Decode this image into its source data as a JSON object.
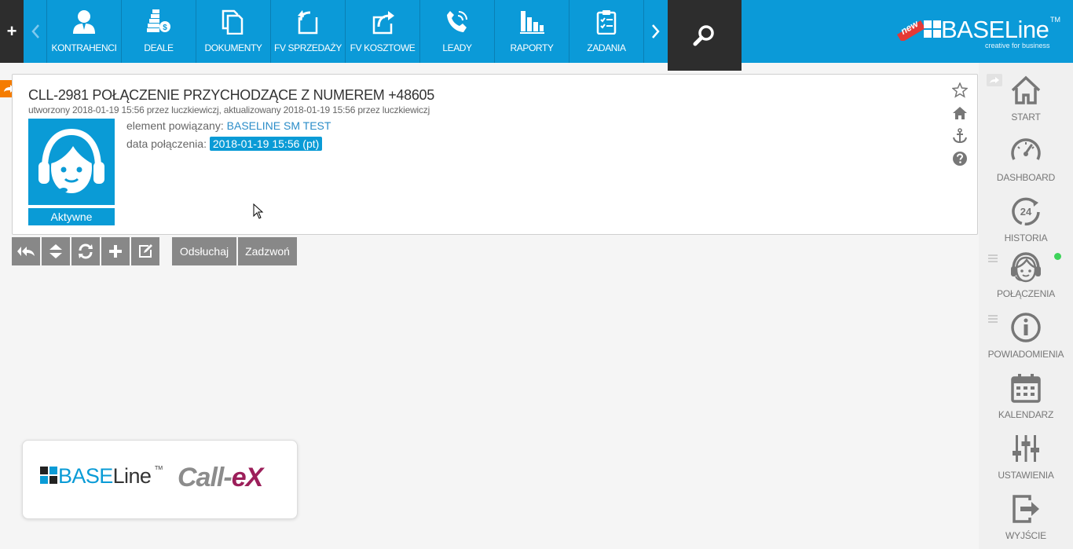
{
  "topbar": {
    "plus_label": "+",
    "nav": [
      {
        "label": "KONTRAHENCI",
        "icon": "person-icon"
      },
      {
        "label": "DEALE",
        "icon": "coins-icon"
      },
      {
        "label": "DOKUMENTY",
        "icon": "documents-icon"
      },
      {
        "label": "FV SPRZEDAŻY",
        "icon": "invoice-out-icon"
      },
      {
        "label": "FV KOSZTOWE",
        "icon": "invoice-in-icon"
      },
      {
        "label": "LEADY",
        "icon": "phone-icon"
      },
      {
        "label": "RAPORTY",
        "icon": "bar-chart-icon"
      },
      {
        "label": "ZADANIA",
        "icon": "clipboard-icon"
      }
    ],
    "brand": {
      "badge": "new",
      "name": "BASELine",
      "tm": "TM",
      "tagline": "creative for business"
    }
  },
  "record": {
    "title": "CLL-2981  POŁĄCZENIE PRZYCHODZĄCE Z NUMEREM +48605",
    "meta": "utworzony 2018-01-19 15:56 przez luczkiewiczj, aktualizowany 2018-01-19 15:56 przez luczkiewiczj",
    "status": "Aktywne",
    "related_label": "element powiązany:",
    "related_value": "BASELINE SM TEST",
    "date_label": "data połączenia:",
    "date_value": "2018-01-19 15:56 (pt)"
  },
  "actions": {
    "listen": "Odsłuchaj",
    "call": "Zadzwoń"
  },
  "sidebar": {
    "items": [
      {
        "label": "START",
        "icon": "home-icon"
      },
      {
        "label": "DASHBOARD",
        "icon": "gauge-icon"
      },
      {
        "label": "HISTORIA",
        "icon": "history-24-icon"
      },
      {
        "label": "POŁĄCZENIA",
        "icon": "headset-icon"
      },
      {
        "label": "POWIADOMIENIA",
        "icon": "info-icon"
      },
      {
        "label": "KALENDARZ",
        "icon": "calendar-icon"
      },
      {
        "label": "USTAWIENIA",
        "icon": "sliders-icon"
      },
      {
        "label": "WYJŚCIE",
        "icon": "exit-icon"
      }
    ]
  },
  "partners": {
    "baseline_prefix": "BASE",
    "baseline_suffix": "Line",
    "baseline_tm": "TM",
    "callex_prefix": "Call-",
    "callex_suffix": "eX"
  },
  "colors": {
    "brand_blue": "#0b9ad8",
    "dark": "#2d2d2d",
    "button_gray": "#888888",
    "accent_orange": "#f57c00",
    "online_green": "#3ed35a",
    "callex_magenta": "#9c1f5a"
  }
}
